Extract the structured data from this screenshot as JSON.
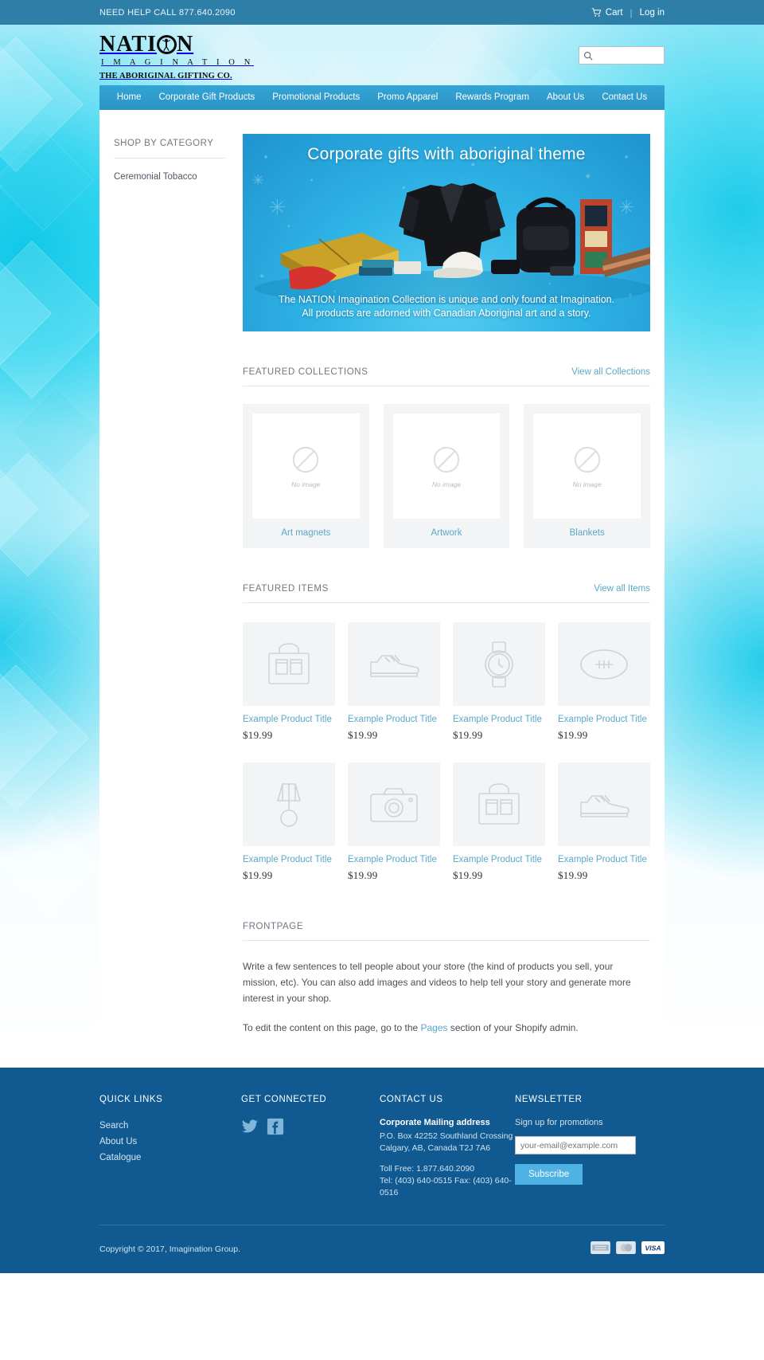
{
  "topbar": {
    "help_text": "NEED HELP CALL 877.640.2090",
    "cart_label": "Cart",
    "cart_icon": "cart-icon",
    "login_label": "Log in",
    "separator": "|"
  },
  "logo": {
    "line1_before": "NATI",
    "line1_after": "N",
    "line2": "I M A G I N A T I O N",
    "tagline": "THE ABORIGINAL GIFTING CO."
  },
  "search": {
    "icon": "search-icon",
    "placeholder": "",
    "value": ""
  },
  "nav": {
    "items": [
      {
        "label": "Home"
      },
      {
        "label": "Corporate Gift Products"
      },
      {
        "label": "Promotional Products"
      },
      {
        "label": "Promo Apparel"
      },
      {
        "label": "Rewards Program"
      },
      {
        "label": "About Us"
      },
      {
        "label": "Contact Us"
      }
    ]
  },
  "sidebar": {
    "title": "SHOP BY CATEGORY",
    "items": [
      {
        "label": "Ceremonial Tobacco"
      }
    ]
  },
  "hero": {
    "headline": "Corporate gifts with aboriginal theme",
    "caption_line1": "The NATION Imagination Collection is unique and only found at Imagination.",
    "caption_line2": "All products are adorned with Canadian Aboriginal art and a story."
  },
  "collections_section": {
    "title": "FEATURED COLLECTIONS",
    "view_all_label": "View all Collections",
    "placeholder_text": "No image",
    "items": [
      {
        "label": "Art magnets"
      },
      {
        "label": "Artwork"
      },
      {
        "label": "Blankets"
      }
    ]
  },
  "items_section": {
    "title": "FEATURED ITEMS",
    "view_all_label": "View all Items",
    "products": [
      {
        "title": "Example Product Title",
        "price": "$19.99",
        "icon": "bag-icon"
      },
      {
        "title": "Example Product Title",
        "price": "$19.99",
        "icon": "shoe-icon"
      },
      {
        "title": "Example Product Title",
        "price": "$19.99",
        "icon": "watch-icon"
      },
      {
        "title": "Example Product Title",
        "price": "$19.99",
        "icon": "football-icon"
      },
      {
        "title": "Example Product Title",
        "price": "$19.99",
        "icon": "lamp-icon"
      },
      {
        "title": "Example Product Title",
        "price": "$19.99",
        "icon": "camera-icon"
      },
      {
        "title": "Example Product Title",
        "price": "$19.99",
        "icon": "bag-icon"
      },
      {
        "title": "Example Product Title",
        "price": "$19.99",
        "icon": "shoe-icon"
      }
    ]
  },
  "frontpage": {
    "title": "FRONTPAGE",
    "paragraph1": "Write a few sentences to tell people about your store (the kind of products you sell, your mission, etc). You can also add images and videos to help tell your story and generate more interest in your shop.",
    "paragraph2_before": "To edit the content on this page, go to the ",
    "paragraph2_link": "Pages",
    "paragraph2_after": " section of your Shopify admin."
  },
  "footer": {
    "quick_links": {
      "title": "QUICK LINKS",
      "items": [
        {
          "label": "Search"
        },
        {
          "label": "About Us"
        },
        {
          "label": "Catalogue"
        }
      ]
    },
    "get_connected": {
      "title": "GET CONNECTED",
      "social": [
        {
          "name": "twitter-icon"
        },
        {
          "name": "facebook-icon"
        }
      ]
    },
    "contact": {
      "title": "CONTACT US",
      "heading": "Corporate Mailing address",
      "address_line1": "P.O. Box 42252 Southland Crossing",
      "address_line2": "Calgary, AB, Canada T2J 7A6",
      "phone_line1": "Toll Free: 1.877.640.2090",
      "phone_line2": "Tel: (403) 640-0515   Fax: (403) 640-",
      "phone_line3": "0516"
    },
    "newsletter": {
      "title": "NEWSLETTER",
      "text": "Sign up for promotions",
      "placeholder": "your-email@example.com",
      "value": "",
      "button_label": "Subscribe"
    },
    "copyright": "Copyright © 2017, Imagination Group.",
    "payment_cards": [
      {
        "name": "amex-icon"
      },
      {
        "name": "mastercard-icon"
      },
      {
        "name": "visa-icon"
      }
    ]
  },
  "colors": {
    "topbar": "#2d7fa8",
    "nav": "#33a5d6",
    "footer": "#115a91",
    "link": "#5ba7c9",
    "accent": "#4eb3e4"
  }
}
